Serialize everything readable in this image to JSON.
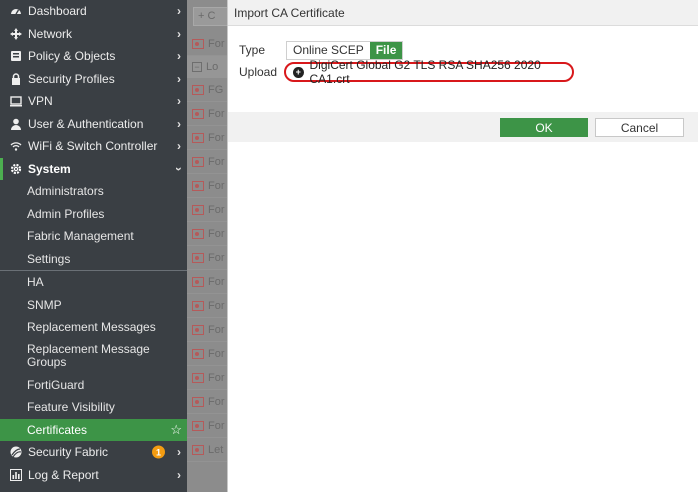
{
  "sidebar": {
    "items": [
      {
        "label": "Dashboard",
        "icon": "dashboard-icon"
      },
      {
        "label": "Network",
        "icon": "network-icon"
      },
      {
        "label": "Policy & Objects",
        "icon": "policy-icon"
      },
      {
        "label": "Security Profiles",
        "icon": "lock-icon"
      },
      {
        "label": "VPN",
        "icon": "monitor-icon"
      },
      {
        "label": "User & Authentication",
        "icon": "user-icon"
      },
      {
        "label": "WiFi & Switch Controller",
        "icon": "wifi-icon"
      }
    ],
    "system": {
      "label": "System",
      "icon": "gear-icon",
      "group1": [
        "Administrators",
        "Admin Profiles",
        "Fabric Management",
        "Settings"
      ],
      "group2": [
        "HA",
        "SNMP",
        "Replacement Messages",
        "Replacement Message Groups",
        "FortiGuard",
        "Feature Visibility"
      ],
      "active": "Certificates"
    },
    "bottom_items": [
      {
        "label": "Security Fabric",
        "icon": "fabric-icon",
        "badge": "1"
      },
      {
        "label": "Log & Report",
        "icon": "chart-icon"
      }
    ]
  },
  "background_list": {
    "create_label": "+ C",
    "rows": [
      "For",
      "Lo",
      "FG",
      "For",
      "For",
      "For",
      "For",
      "For",
      "For",
      "For",
      "For",
      "For",
      "For",
      "For",
      "For",
      "For",
      "For",
      "Let"
    ]
  },
  "dialog": {
    "title": "Import CA Certificate",
    "type_label": "Type",
    "type_options": [
      "Online SCEP",
      "File"
    ],
    "type_selected": "File",
    "upload_label": "Upload",
    "upload_file": "DigiCert Global G2 TLS RSA SHA256 2020 CA1.crt",
    "ok_label": "OK",
    "cancel_label": "Cancel"
  },
  "colors": {
    "accent": "#3d9447",
    "sidebar_bg": "#3a3f44",
    "highlight_ring": "#d8181b",
    "badge": "#f39c12"
  }
}
